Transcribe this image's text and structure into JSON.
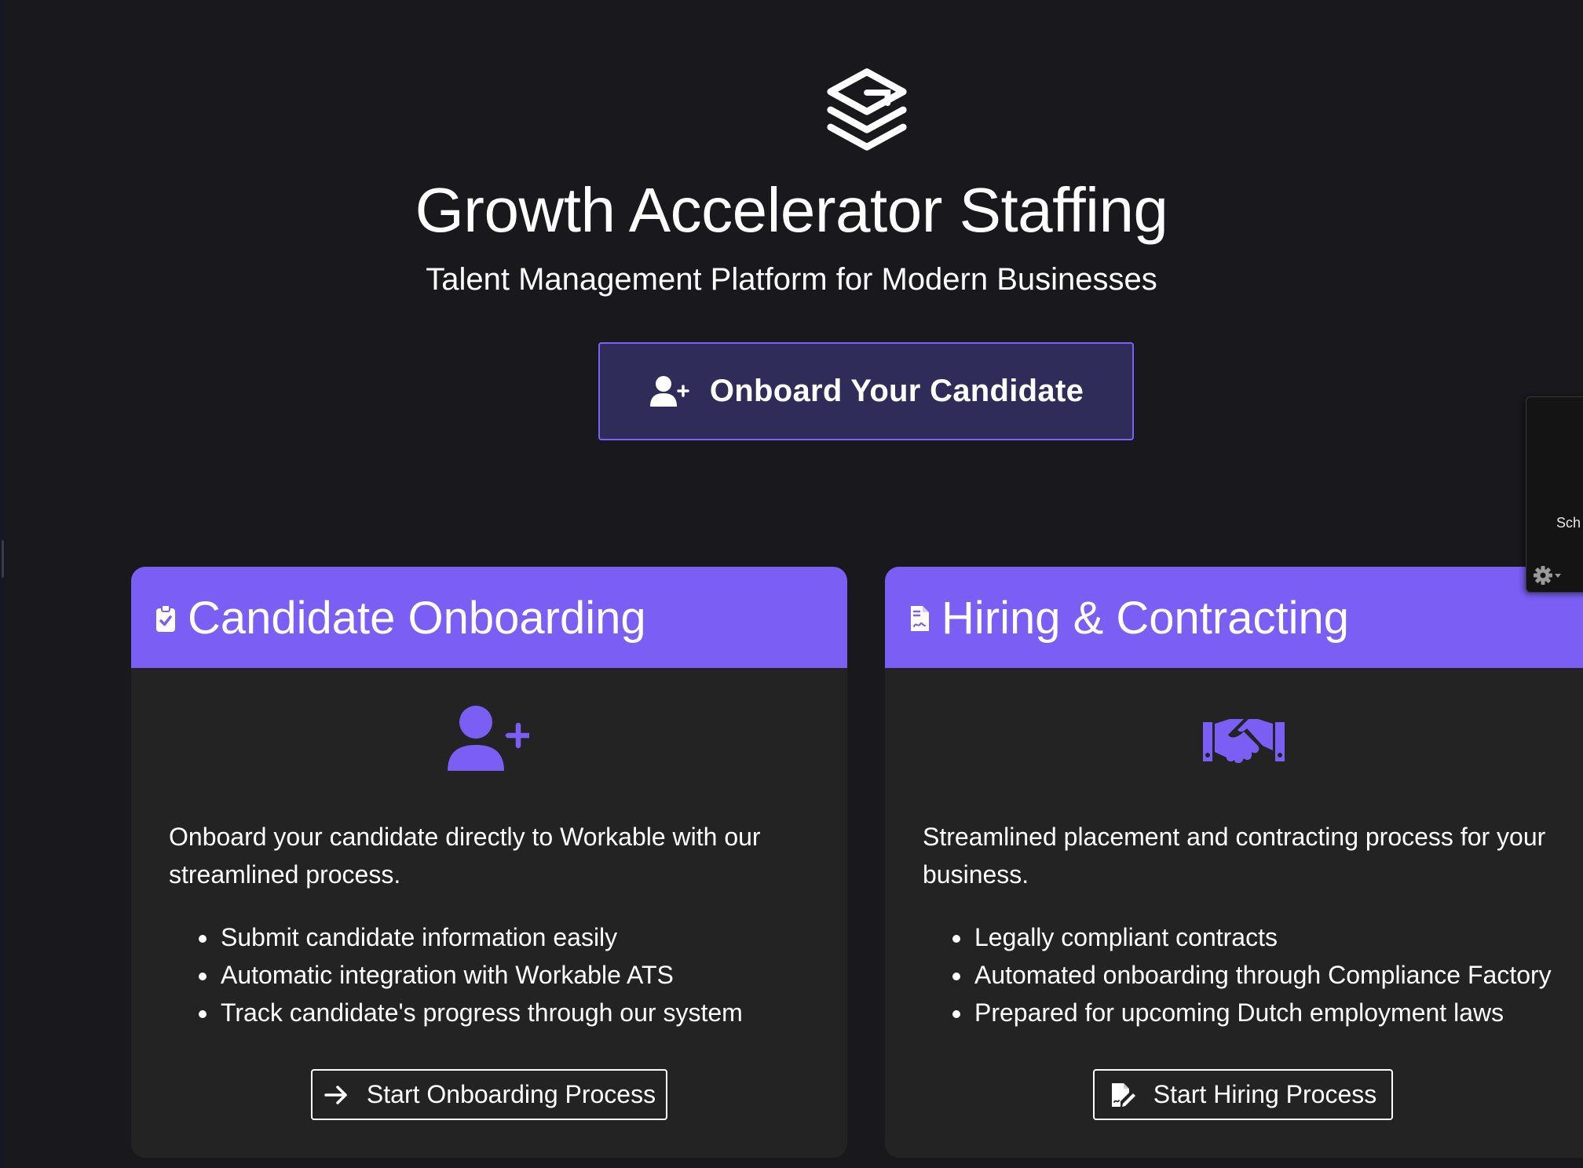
{
  "brand": {
    "logo_icon": "layered-g-logo-icon",
    "title": "Growth Accelerator Staffing",
    "subtitle": "Talent Management Platform for Modern Businesses"
  },
  "cta": {
    "label": "Onboard Your Candidate",
    "icon": "user-plus-icon"
  },
  "cards": [
    {
      "header_icon": "clipboard-check-icon",
      "title": "Candidate Onboarding",
      "feature_icon": "user-plus-icon",
      "description": "Onboard your candidate directly to Workable with our streamlined process.",
      "bullets": [
        "Submit candidate information easily",
        "Automatic integration with Workable ATS",
        "Track candidate's progress through our system"
      ],
      "button_label": "Start Onboarding Process",
      "button_icon": "arrow-right-icon"
    },
    {
      "header_icon": "file-contract-icon",
      "title": "Hiring & Contracting",
      "feature_icon": "handshake-icon",
      "description": "Streamlined placement and contracting process for your business.",
      "bullets": [
        "Legally compliant contracts",
        "Automated onboarding through Compliance Factory",
        "Prepared for upcoming Dutch employment laws"
      ],
      "button_label": "Start Hiring Process",
      "button_icon": "file-signature-icon"
    }
  ],
  "side_widget": {
    "label": "Sch",
    "icon": "gear-icon"
  },
  "colors": {
    "background": "#18181d",
    "accent": "#7b5ff5",
    "cta_background": "#2f2c5a",
    "card_background": "#232323"
  }
}
